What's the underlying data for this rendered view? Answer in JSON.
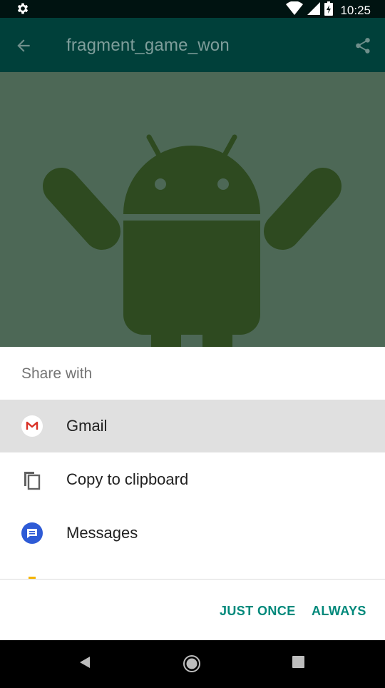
{
  "status_bar": {
    "time": "10:25",
    "icons": [
      "settings-gear-icon",
      "wifi-icon",
      "signal-icon",
      "battery-charging-icon"
    ]
  },
  "app_bar": {
    "title": "fragment_game_won",
    "icons": [
      "back-arrow-icon",
      "share-icon"
    ]
  },
  "content": {
    "image": "android-robot-icon",
    "background_color": "#4d6856",
    "robot_color": "#2e4a20"
  },
  "share_sheet": {
    "heading": "Share with",
    "apps": [
      {
        "label": "Gmail",
        "icon": "gmail-icon",
        "selected": true
      },
      {
        "label": "Copy to clipboard",
        "icon": "clipboard-icon",
        "selected": false
      },
      {
        "label": "Messages",
        "icon": "messages-icon",
        "selected": false
      }
    ],
    "buttons": {
      "just_once": "JUST ONCE",
      "always": "ALWAYS"
    }
  },
  "nav_bar": {
    "icons": [
      "back-nav-icon",
      "home-nav-icon",
      "recents-nav-icon"
    ]
  },
  "colors": {
    "app_bar": "#00403a",
    "accent": "#00897b",
    "selected_row": "#e0e0e0"
  }
}
